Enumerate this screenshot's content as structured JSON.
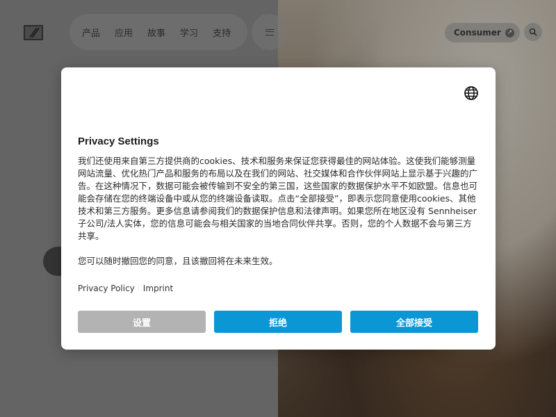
{
  "header": {
    "nav_items": [
      "产品",
      "应用",
      "故事",
      "学习",
      "支持"
    ],
    "consumer_label": "Consumer",
    "icons": [
      "sennheiser-logo",
      "menu-icon",
      "arrow-up-right-icon",
      "search-icon"
    ]
  },
  "modal": {
    "title": "Privacy Settings",
    "paragraphs": [
      "我们还使用来自第三方提供商的cookies、技术和服务来保证您获得最佳的网站体验。这使我们能够测量网站流量、优化热门产品和服务的布局以及在我们的网站、社交媒体和合作伙伴网站上显示基于兴趣的广告。在这种情况下，数据可能会被传输到不安全的第三国，这些国家的数据保护水平不如欧盟。信息也可能会存储在您的终端设备中或从您的终端设备读取。点击“全部接受”，即表示您同意使用cookies、其他技术和第三方服务。更多信息请参阅我们的数据保护信息和法律声明。如果您所在地区没有 Sennheiser 子公司/法人实体，您的信息可能会与相关国家的当地合同伙伴共享。否则，您的个人数据不会与第三方共享。",
      "您可以随时撤回您的同意，且该撤回将在未来生效。"
    ],
    "links": {
      "privacy_policy": "Privacy Policy",
      "imprint": "Imprint"
    },
    "buttons": {
      "settings": "设置",
      "reject": "拒绝",
      "accept_all": "全部接受"
    },
    "language_icon": "globe-icon"
  },
  "colors": {
    "primary_button": "#0b96d6",
    "secondary_button": "#b3b3b3"
  }
}
